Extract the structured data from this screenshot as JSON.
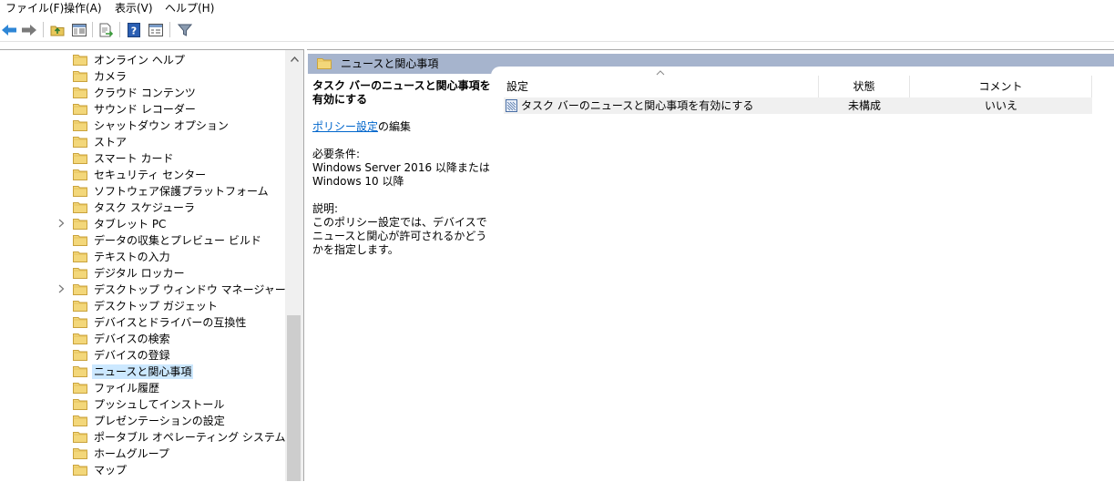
{
  "menu": {
    "file": "ファイル(F)",
    "action": "操作(A)",
    "view": "表示(V)",
    "help": "ヘルプ(H)"
  },
  "toolbar": {
    "icons": [
      "back-arrow-icon",
      "forward-arrow-icon",
      "up-folder-icon",
      "show-hide-tree-icon",
      "export-list-icon",
      "help-icon",
      "properties-icon",
      "filter-icon"
    ]
  },
  "tree": {
    "items": [
      {
        "label": "オンライン ヘルプ",
        "expandable": false
      },
      {
        "label": "カメラ",
        "expandable": false
      },
      {
        "label": "クラウド コンテンツ",
        "expandable": false
      },
      {
        "label": "サウンド レコーダー",
        "expandable": false
      },
      {
        "label": "シャットダウン オプション",
        "expandable": false
      },
      {
        "label": "ストア",
        "expandable": false
      },
      {
        "label": "スマート カード",
        "expandable": false
      },
      {
        "label": "セキュリティ センター",
        "expandable": false
      },
      {
        "label": "ソフトウェア保護プラットフォーム",
        "expandable": false
      },
      {
        "label": "タスク スケジューラ",
        "expandable": false
      },
      {
        "label": "タブレット PC",
        "expandable": true
      },
      {
        "label": "データの収集とプレビュー ビルド",
        "expandable": false
      },
      {
        "label": "テキストの入力",
        "expandable": false
      },
      {
        "label": "デジタル ロッカー",
        "expandable": false
      },
      {
        "label": "デスクトップ ウィンドウ マネージャー",
        "expandable": true
      },
      {
        "label": "デスクトップ ガジェット",
        "expandable": false
      },
      {
        "label": "デバイスとドライバーの互換性",
        "expandable": false
      },
      {
        "label": "デバイスの検索",
        "expandable": false
      },
      {
        "label": "デバイスの登録",
        "expandable": false
      },
      {
        "label": "ニュースと関心事項",
        "expandable": false,
        "selected": true
      },
      {
        "label": "ファイル履歴",
        "expandable": false
      },
      {
        "label": "プッシュしてインストール",
        "expandable": false
      },
      {
        "label": "プレゼンテーションの設定",
        "expandable": false
      },
      {
        "label": "ポータブル オペレーティング システム",
        "expandable": false
      },
      {
        "label": "ホームグループ",
        "expandable": false
      },
      {
        "label": "マップ",
        "expandable": false
      }
    ]
  },
  "header": {
    "title": "ニュースと関心事項"
  },
  "description": {
    "policy_title": "タスク バーのニュースと関心事項を有効にする",
    "edit_link": "ポリシー設定",
    "edit_suffix": "の編集",
    "requirements_label": "必要条件:",
    "requirements_line1": "Windows Server 2016 以降または",
    "requirements_line2": "Windows 10 以降",
    "explanation_label": "説明:",
    "explanation_text": "このポリシー設定では、デバイスでニュースと関心が許可されるかどうかを指定します。"
  },
  "list": {
    "columns": {
      "setting": "設定",
      "state": "状態",
      "comment": "コメント"
    },
    "rows": [
      {
        "setting": "タスク バーのニュースと関心事項を有効にする",
        "state": "未構成",
        "comment": "いいえ"
      }
    ]
  }
}
